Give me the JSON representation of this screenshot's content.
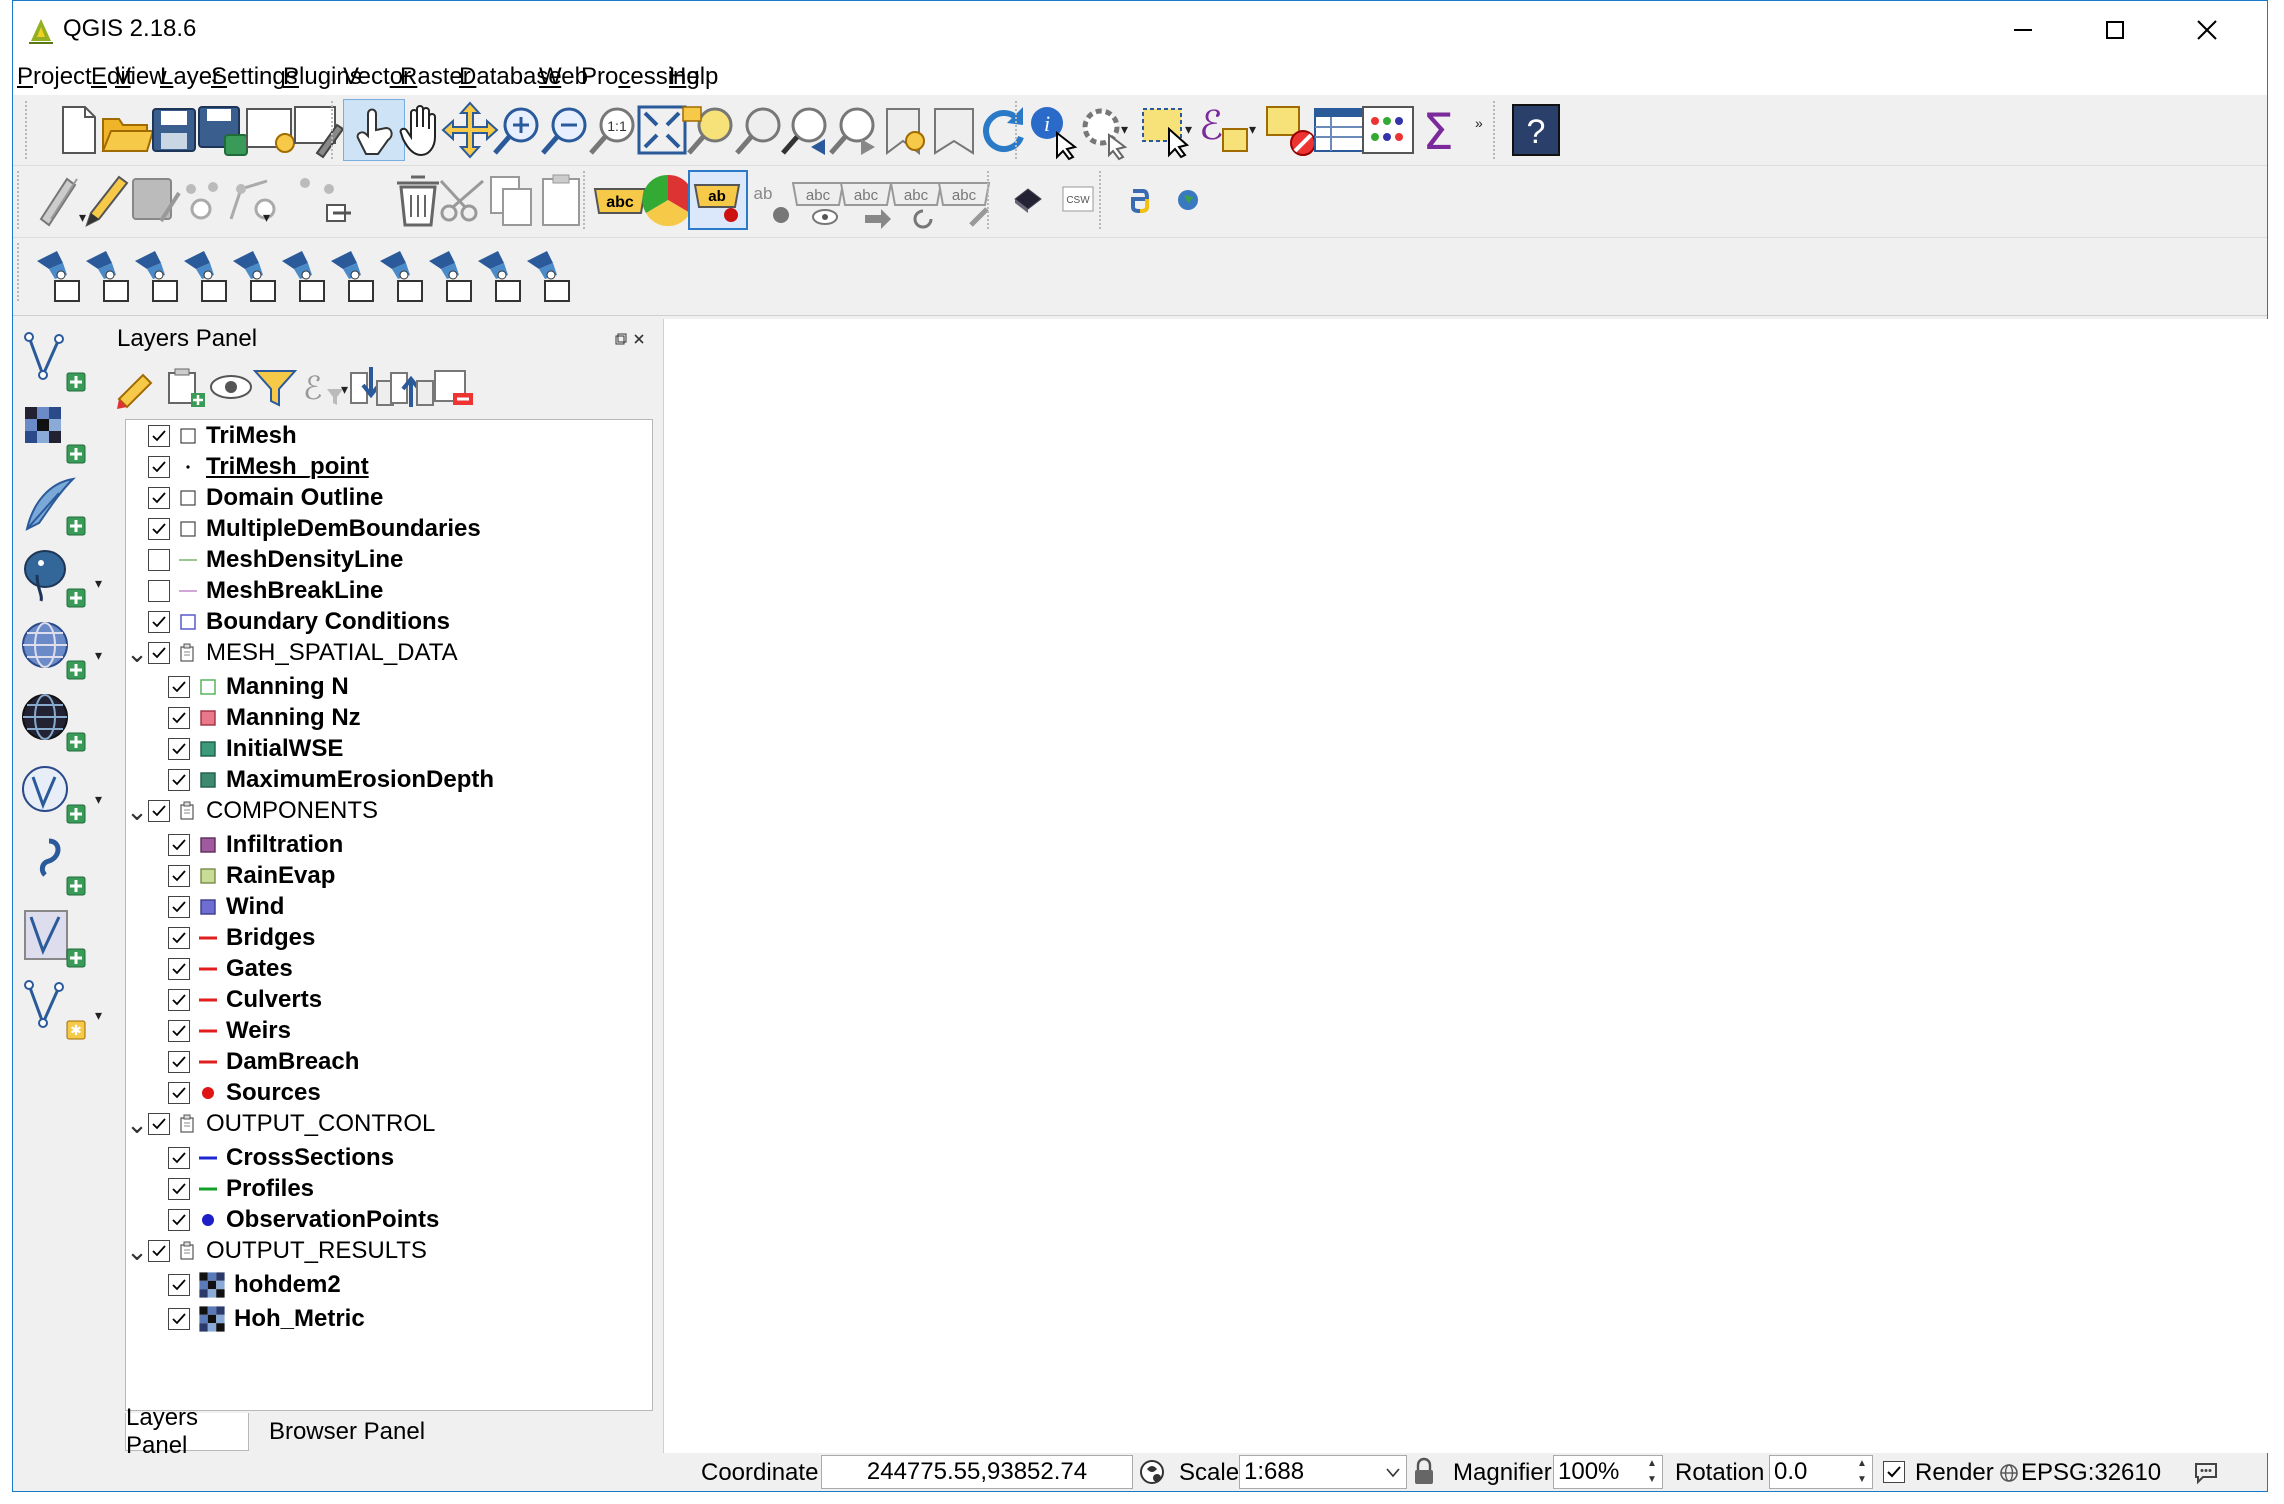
{
  "window": {
    "title": "QGIS 2.18.6",
    "controls": [
      "minimize",
      "maximize",
      "close"
    ]
  },
  "menu": [
    {
      "label": "Project",
      "u": "P",
      "rest": "roject"
    },
    {
      "label": "Edit",
      "u": "E",
      "rest": "dit"
    },
    {
      "label": "View",
      "u": "V",
      "rest": "iew"
    },
    {
      "label": "Layer",
      "u": "L",
      "rest": "ayer"
    },
    {
      "label": "Settings",
      "u": "S",
      "rest": "ettings"
    },
    {
      "label": "Plugins",
      "u": "P",
      "rest": "lugins"
    },
    {
      "label": "Vector",
      "pre": "Vect",
      "u": "o",
      "rest": "r"
    },
    {
      "label": "Raster",
      "u": "R",
      "rest": "aster"
    },
    {
      "label": "Database",
      "u": "D",
      "rest": "atabase"
    },
    {
      "label": "Web",
      "u": "W",
      "rest": "eb"
    },
    {
      "label": "Processing",
      "pre": "Pro",
      "u": "c",
      "rest": "essing"
    },
    {
      "label": "Help",
      "u": "H",
      "rest": "elp"
    }
  ],
  "toolbar1": [
    "new-project",
    "open-project",
    "save-project",
    "save-as",
    "new-print-composer",
    "composer-manager",
    "touch-zoom-pan",
    "pan-map",
    "pan-to-selection",
    "zoom-in",
    "zoom-out",
    "zoom-native",
    "zoom-full",
    "zoom-to-selection",
    "zoom-to-layer",
    "zoom-last",
    "zoom-next",
    "new-bookmark",
    "show-bookmarks",
    "refresh",
    "identify-features",
    "run-feature-action",
    "select-features",
    "select-by-expression",
    "deselect-all",
    "open-attribute-table",
    "statistical-summary",
    "show-statistics",
    "help"
  ],
  "toolbar2": [
    "current-edits",
    "toggle-editing",
    "save-edits",
    "add-feature",
    "move-feature",
    "node-tool",
    "delete-selected",
    "cut-features",
    "copy-features",
    "paste-features",
    "layer-labeling",
    "layer-diagram",
    "highlight-pinned-labels",
    "pin-labels",
    "show-hide-labels",
    "move-label",
    "rotate-label",
    "change-label",
    "metasearch",
    "csw",
    "python-console",
    "globe"
  ],
  "toolbar3": [
    "mesh-tool-1",
    "mesh-tool-2",
    "mesh-tool-3",
    "mesh-tool-4",
    "mesh-tool-5",
    "mesh-tool-6",
    "mesh-tool-7",
    "mesh-tool-8",
    "mesh-tool-9",
    "mesh-tool-10",
    "mesh-tool-11"
  ],
  "left_toolbar": [
    "add-vector-layer",
    "add-raster-layer",
    "add-delimited-text-layer",
    "add-postgis-layer",
    "add-wms-layer",
    "add-wcs-layer",
    "add-wfs-layer",
    "add-virtual-layer",
    "new-shapefile-layer",
    "new-spatialite-layer"
  ],
  "layers_panel": {
    "title": "Layers Panel",
    "tools": [
      "style-manager",
      "add-group",
      "manage-visibility",
      "filter-legend",
      "filter-by-expression",
      "expand-all",
      "collapse-all",
      "remove-layer"
    ],
    "tree": [
      {
        "level": 0,
        "label": "TriMesh",
        "checked": true,
        "sym": "poly-empty",
        "color": "#ffffff"
      },
      {
        "level": 0,
        "label": "TriMesh_point",
        "checked": true,
        "sym": "dot-small",
        "color": "#000000",
        "underline": true
      },
      {
        "level": 0,
        "label": "Domain Outline",
        "checked": true,
        "sym": "poly-empty",
        "color": "#ffffff"
      },
      {
        "level": 0,
        "label": "MultipleDemBoundaries",
        "checked": true,
        "sym": "poly-empty",
        "color": "#ffffff"
      },
      {
        "level": 0,
        "label": "MeshDensityLine",
        "checked": false,
        "sym": "line",
        "color": "#7cb56a"
      },
      {
        "level": 0,
        "label": "MeshBreakLine",
        "checked": false,
        "sym": "line",
        "color": "#c08ac8"
      },
      {
        "level": 0,
        "label": "Boundary Conditions",
        "checked": true,
        "sym": "poly",
        "color": "#ffffff",
        "border": "#4e4ec8"
      },
      {
        "level": 0,
        "label": "MESH_SPATIAL_DATA",
        "checked": true,
        "sym": "group",
        "group": true
      },
      {
        "level": 1,
        "label": "Manning N",
        "checked": true,
        "sym": "poly",
        "color": "#ffffff",
        "border": "#4caf50"
      },
      {
        "level": 1,
        "label": "Manning Nz",
        "checked": true,
        "sym": "poly",
        "color": "#e8788a",
        "border": "#a03040"
      },
      {
        "level": 1,
        "label": "InitialWSE",
        "checked": true,
        "sym": "poly",
        "color": "#3c9a7c",
        "border": "#1e5c48"
      },
      {
        "level": 1,
        "label": "MaximumErosionDepth",
        "checked": true,
        "sym": "poly",
        "color": "#3e8a6e",
        "border": "#1e5c48"
      },
      {
        "level": 0,
        "label": "COMPONENTS",
        "checked": true,
        "sym": "group",
        "group": true
      },
      {
        "level": 1,
        "label": "Infiltration",
        "checked": true,
        "sym": "poly",
        "color": "#a05aa0",
        "border": "#5a2a5a"
      },
      {
        "level": 1,
        "label": "RainEvap",
        "checked": true,
        "sym": "poly",
        "color": "#c8dc96",
        "border": "#7a8a4a"
      },
      {
        "level": 1,
        "label": "Wind",
        "checked": true,
        "sym": "poly",
        "color": "#6e6ed2",
        "border": "#3a3a8a"
      },
      {
        "level": 1,
        "label": "Bridges",
        "checked": true,
        "sym": "line",
        "color": "#e01e1e"
      },
      {
        "level": 1,
        "label": "Gates",
        "checked": true,
        "sym": "line",
        "color": "#e01e1e"
      },
      {
        "level": 1,
        "label": "Culverts",
        "checked": true,
        "sym": "line",
        "color": "#e01e1e"
      },
      {
        "level": 1,
        "label": "Weirs",
        "checked": true,
        "sym": "line",
        "color": "#e01e1e"
      },
      {
        "level": 1,
        "label": "DamBreach",
        "checked": true,
        "sym": "line",
        "color": "#e01e1e"
      },
      {
        "level": 1,
        "label": "Sources",
        "checked": true,
        "sym": "dot",
        "color": "#e01414"
      },
      {
        "level": 0,
        "label": "OUTPUT_CONTROL",
        "checked": true,
        "sym": "group",
        "group": true
      },
      {
        "level": 1,
        "label": "CrossSections",
        "checked": true,
        "sym": "line",
        "color": "#1e28d2"
      },
      {
        "level": 1,
        "label": "Profiles",
        "checked": true,
        "sym": "line",
        "color": "#14a028"
      },
      {
        "level": 1,
        "label": "ObservationPoints",
        "checked": true,
        "sym": "dot",
        "color": "#1e1ec8"
      },
      {
        "level": 0,
        "label": "OUTPUT_RESULTS",
        "checked": true,
        "sym": "group",
        "group": true
      },
      {
        "level": 1,
        "label": "hohdem2",
        "checked": true,
        "sym": "raster"
      },
      {
        "level": 1,
        "label": "Hoh_Metric",
        "checked": true,
        "sym": "raster"
      }
    ],
    "tabs": [
      "Layers Panel",
      "Browser Panel"
    ],
    "active_tab": "Layers Panel"
  },
  "status": {
    "coordinate_label": "Coordinate",
    "coordinate_value": "244775.55,93852.74",
    "scale_label": "Scale",
    "scale_value": "1:688",
    "magnifier_label": "Magnifier",
    "magnifier_value": "100%",
    "rotation_label": "Rotation",
    "rotation_value": "0.0",
    "render_label": "Render",
    "render_checked": true,
    "crs": "EPSG:32610"
  }
}
